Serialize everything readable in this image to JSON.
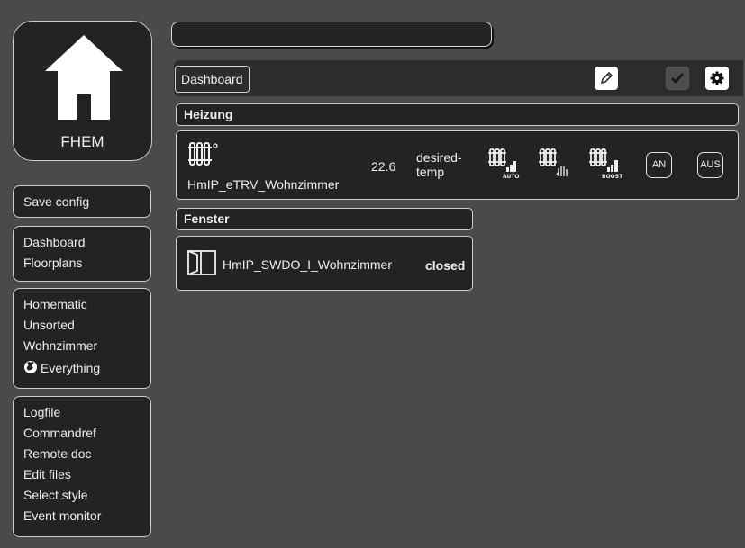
{
  "logo": {
    "text": "FHEM"
  },
  "search": {
    "value": ""
  },
  "sidebar": {
    "save_config": "Save config",
    "group1": [
      "Dashboard",
      "Floorplans"
    ],
    "group2": [
      "Homematic",
      "Unsorted",
      "Wohnzimmer",
      "Everything"
    ],
    "group3": [
      "Logfile",
      "Commandref",
      "Remote doc",
      "Edit files",
      "Select style",
      "Event monitor"
    ]
  },
  "toolbar": {
    "dashboard_label": "Dashboard"
  },
  "heizung": {
    "title": "Heizung",
    "device_name": "HmIP_eTRV_Wohnzimmer",
    "temperature": "22.6",
    "desired_label_line1": "desired-",
    "desired_label_line2": "temp",
    "btn_an": "AN",
    "btn_aus": "AUS"
  },
  "fenster": {
    "title": "Fenster",
    "device_name": "HmIP_SWDO_I_Wohnzimmer",
    "state": "closed"
  },
  "colors": {
    "background": "#4a4a4a",
    "panel": "#232323",
    "border": "#cfcfcf",
    "save_green": "#4caf50"
  }
}
